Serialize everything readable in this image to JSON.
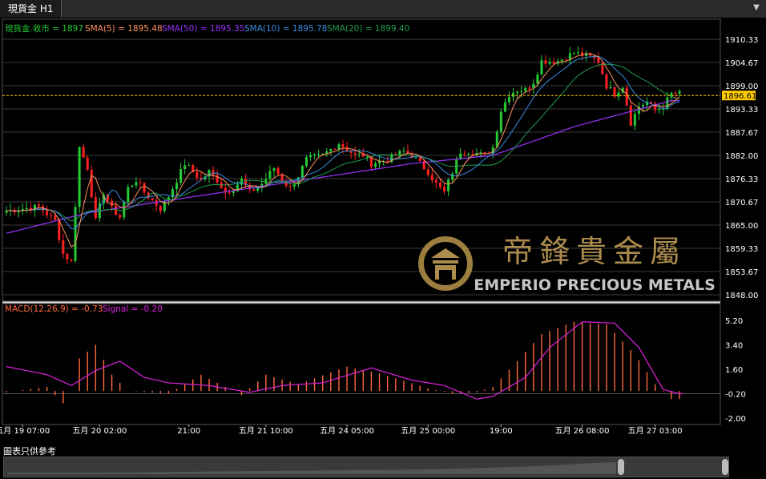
{
  "window": {
    "tab_label": "現貨金 H1",
    "footer_note": "圖表只供參考"
  },
  "colors": {
    "up": "#25c935",
    "down": "#ff2020",
    "grid": "#3c3c3c",
    "sma5": "#ff9060",
    "sma10": "#3a8ee6",
    "sma20": "#1e9e4e",
    "sma50": "#9933ff",
    "macd": "#ff6a3a",
    "signal": "#e020e0",
    "price_line": "#ffcc00"
  },
  "legend": {
    "close": {
      "text": "現貨金.收市 = 1897",
      "color": "#25c935"
    },
    "sma5": {
      "text": "SMA(5) = 1895.48",
      "color": "#ff9060"
    },
    "sma50": {
      "text": "SMA(50) = 1895.35",
      "color": "#9933ff"
    },
    "sma10": {
      "text": "SMA(10) = 1895.78",
      "color": "#3a8ee6"
    },
    "sma20": {
      "text": "SMA(20) = 1899.40",
      "color": "#1e9e4e"
    }
  },
  "macd_legend": {
    "macd": "MACD(12,26,9) = -0.73",
    "signal": "Signal = -0.20"
  },
  "watermark": {
    "cn": "帝鋒貴金屬",
    "en": "EMPERIO PRECIOUS METALS"
  },
  "current_price_label": "1896.61",
  "chart_data": {
    "type": "candlestick",
    "price_axis": {
      "ticks": [
        "1910.33",
        "1904.67",
        "1899.00",
        "1893.33",
        "1887.67",
        "1882.00",
        "1876.33",
        "1870.67",
        "1865.00",
        "1859.33",
        "1853.67",
        "1848.00"
      ],
      "ylim": [
        1848.0,
        1910.33
      ]
    },
    "macd_axis": {
      "ticks": [
        "5.20",
        "3.40",
        "1.60",
        "-0.20",
        "-2.00"
      ],
      "ylim": [
        -2.0,
        5.2
      ]
    },
    "x_labels": [
      "五月 19 07:00",
      "五月 20 02:00",
      "21:00",
      "五月 21 10:00",
      "五月 24 05:00",
      "五月 25 00:00",
      "19:00",
      "五月 26 08:00",
      "五月 27 03:00"
    ],
    "x_label_index": [
      4,
      23,
      45,
      64,
      84,
      104,
      122,
      142,
      160
    ],
    "current_price": 1896.61,
    "series_close_anchors": [
      [
        0,
        1868.5
      ],
      [
        4,
        1869
      ],
      [
        8,
        1869.5
      ],
      [
        12,
        1866
      ],
      [
        14,
        1858
      ],
      [
        16,
        1856
      ],
      [
        18,
        1884
      ],
      [
        20,
        1879
      ],
      [
        22,
        1866
      ],
      [
        24,
        1873
      ],
      [
        26,
        1869
      ],
      [
        28,
        1867
      ],
      [
        30,
        1874
      ],
      [
        32,
        1876
      ],
      [
        34,
        1873
      ],
      [
        36,
        1871
      ],
      [
        38,
        1869
      ],
      [
        40,
        1872
      ],
      [
        44,
        1880
      ],
      [
        46,
        1878
      ],
      [
        48,
        1876
      ],
      [
        50,
        1878
      ],
      [
        52,
        1876
      ],
      [
        54,
        1873
      ],
      [
        56,
        1874
      ],
      [
        58,
        1876
      ],
      [
        60,
        1873
      ],
      [
        63,
        1875
      ],
      [
        66,
        1879
      ],
      [
        68,
        1876
      ],
      [
        70,
        1874
      ],
      [
        72,
        1877
      ],
      [
        74,
        1881
      ],
      [
        78,
        1882
      ],
      [
        82,
        1885
      ],
      [
        86,
        1882
      ],
      [
        88,
        1882
      ],
      [
        90,
        1880
      ],
      [
        94,
        1881
      ],
      [
        98,
        1883
      ],
      [
        100,
        1882
      ],
      [
        104,
        1878
      ],
      [
        106,
        1875
      ],
      [
        108,
        1873
      ],
      [
        110,
        1878
      ],
      [
        112,
        1883
      ],
      [
        114,
        1883
      ],
      [
        118,
        1882
      ],
      [
        120,
        1884
      ],
      [
        122,
        1893
      ],
      [
        124,
        1897
      ],
      [
        126,
        1898
      ],
      [
        128,
        1898
      ],
      [
        130,
        1900
      ],
      [
        132,
        1905
      ],
      [
        136,
        1905
      ],
      [
        140,
        1907
      ],
      [
        144,
        1906
      ],
      [
        146,
        1905
      ],
      [
        148,
        1899
      ],
      [
        150,
        1897
      ],
      [
        152,
        1899
      ],
      [
        154,
        1890
      ],
      [
        156,
        1894
      ],
      [
        158,
        1895
      ],
      [
        160,
        1893
      ],
      [
        162,
        1894
      ],
      [
        164,
        1897
      ]
    ],
    "sma50_anchors": [
      [
        0,
        1863
      ],
      [
        20,
        1868
      ],
      [
        40,
        1871
      ],
      [
        60,
        1874
      ],
      [
        80,
        1877
      ],
      [
        100,
        1880
      ],
      [
        120,
        1882
      ],
      [
        140,
        1889
      ],
      [
        155,
        1893
      ],
      [
        164,
        1895.35
      ]
    ],
    "macd_hist_anchors": [
      [
        0,
        -0.1
      ],
      [
        10,
        0.3
      ],
      [
        15,
        -1.2
      ],
      [
        18,
        2.4
      ],
      [
        22,
        3.4
      ],
      [
        26,
        1.2
      ],
      [
        30,
        0.0
      ],
      [
        40,
        -0.2
      ],
      [
        48,
        1.2
      ],
      [
        58,
        -0.3
      ],
      [
        64,
        1.2
      ],
      [
        72,
        0.5
      ],
      [
        84,
        1.8
      ],
      [
        92,
        1.3
      ],
      [
        104,
        0.2
      ],
      [
        110,
        -0.2
      ],
      [
        116,
        -0.1
      ],
      [
        120,
        0.3
      ],
      [
        126,
        2.2
      ],
      [
        132,
        4.2
      ],
      [
        140,
        5.1
      ],
      [
        148,
        4.9
      ],
      [
        155,
        2.7
      ],
      [
        160,
        0.5
      ],
      [
        164,
        -0.6
      ]
    ],
    "signal_anchors": [
      [
        0,
        1.8
      ],
      [
        10,
        1.2
      ],
      [
        16,
        0.4
      ],
      [
        22,
        1.5
      ],
      [
        28,
        2.2
      ],
      [
        34,
        1.0
      ],
      [
        40,
        0.6
      ],
      [
        50,
        0.4
      ],
      [
        60,
        -0.1
      ],
      [
        68,
        0.4
      ],
      [
        78,
        0.6
      ],
      [
        90,
        1.7
      ],
      [
        100,
        0.8
      ],
      [
        108,
        0.4
      ],
      [
        116,
        -0.6
      ],
      [
        120,
        -0.4
      ],
      [
        128,
        1.0
      ],
      [
        134,
        3.2
      ],
      [
        142,
        5.1
      ],
      [
        150,
        5.0
      ],
      [
        156,
        3.2
      ],
      [
        162,
        0.1
      ],
      [
        166,
        -0.2
      ]
    ]
  }
}
